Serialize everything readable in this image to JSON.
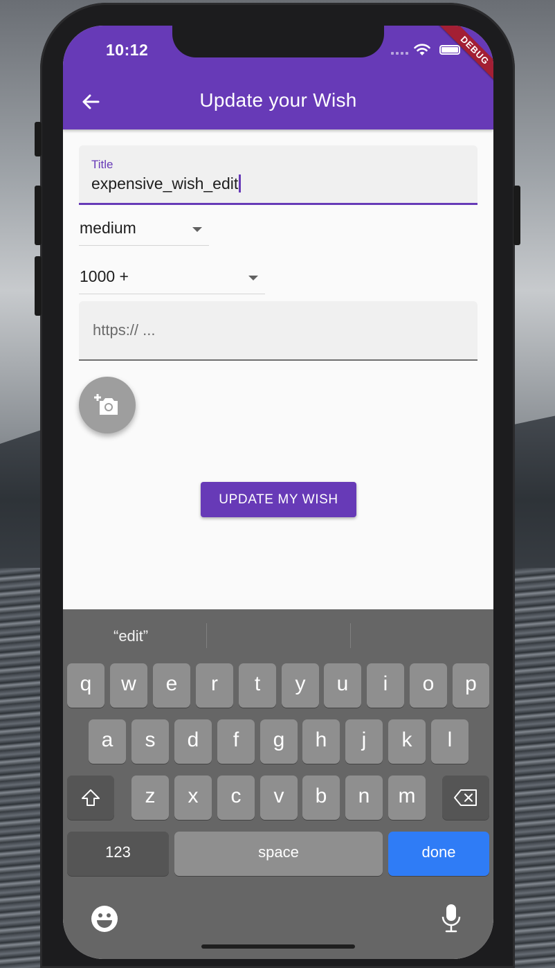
{
  "status_bar": {
    "time": "10:12",
    "debug_banner": "DEBUG"
  },
  "app_bar": {
    "title": "Update your Wish"
  },
  "form": {
    "title_field": {
      "label": "Title",
      "value": "expensive_wish_edit"
    },
    "priority_dropdown": {
      "value": "medium"
    },
    "price_dropdown": {
      "value": "1000 +"
    },
    "url_field": {
      "placeholder": "https:// ..."
    },
    "submit_label": "UPDATE MY WISH"
  },
  "keyboard": {
    "suggestion": "“edit”",
    "rows": [
      [
        "q",
        "w",
        "e",
        "r",
        "t",
        "y",
        "u",
        "i",
        "o",
        "p"
      ],
      [
        "a",
        "s",
        "d",
        "f",
        "g",
        "h",
        "j",
        "k",
        "l"
      ],
      [
        "z",
        "x",
        "c",
        "v",
        "b",
        "n",
        "m"
      ]
    ],
    "numbers_label": "123",
    "space_label": "space",
    "done_label": "done"
  },
  "colors": {
    "primary": "#673ab7",
    "done_key": "#2f7cf6",
    "fab": "#9e9e9e"
  }
}
